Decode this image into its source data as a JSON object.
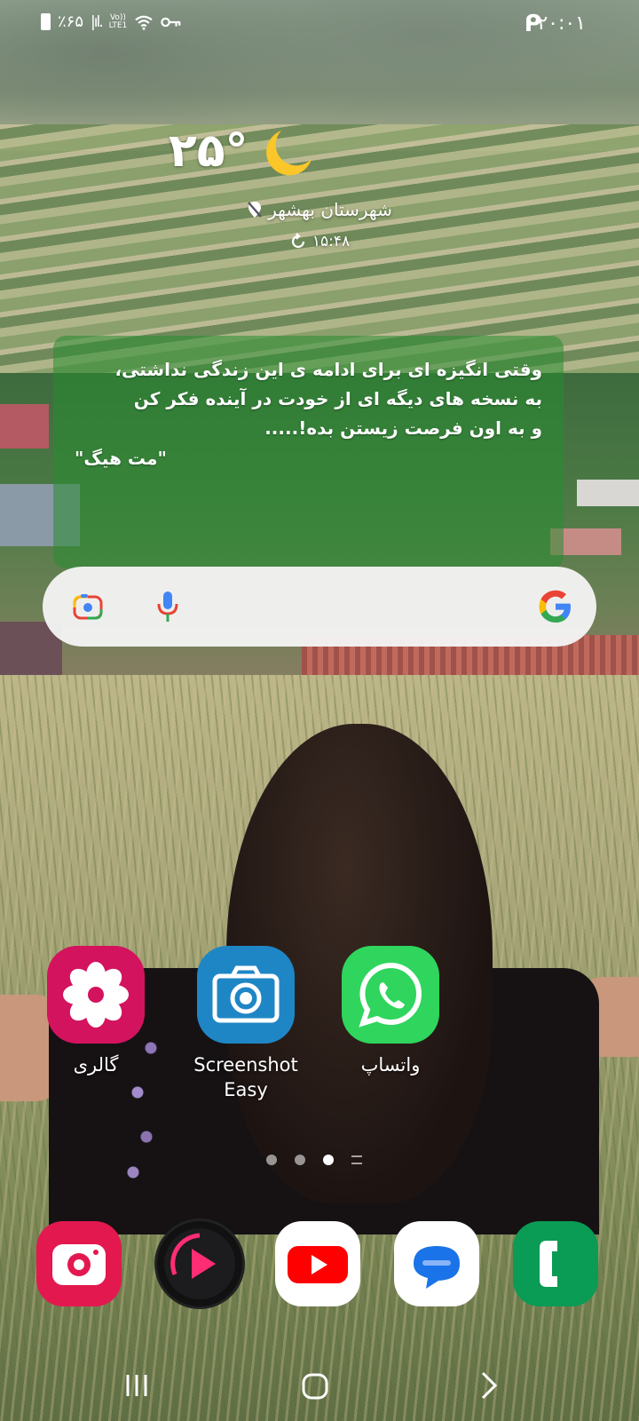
{
  "status_bar": {
    "battery_text": "٪۶۵",
    "network": "LTE1",
    "volte": "Vo))",
    "time": "۲۰:۰۱",
    "notification_icon": "p-icon"
  },
  "weather": {
    "temperature": "۲۵°",
    "condition_icon": "moon-icon",
    "location": "شهرستان بهشهر",
    "updated_time": "۱۵:۴۸"
  },
  "quote": {
    "line1": "وقتی انگیزه ای برای ادامه ی این زندگی نداشتی،",
    "line2": "به نسخه های دیگه ای از خودت در آینده فکر کن",
    "line3": "و به اون فرصت زیستن بده!.....",
    "author": "\"مت هیگ\""
  },
  "search_bar": {
    "lens_icon": "google-lens-icon",
    "mic_icon": "microphone-icon",
    "logo_icon": "google-logo-icon"
  },
  "apps": [
    {
      "label": "گالری",
      "icon": "gallery-flower-icon",
      "color": "#d3135e"
    },
    {
      "label": "Screenshot Easy",
      "icon": "camera-icon",
      "color": "#1f86c6"
    },
    {
      "label": "واتساپ",
      "icon": "whatsapp-icon",
      "color": "#2fd55c"
    }
  ],
  "dock": [
    {
      "icon": "camera-app-icon",
      "color": "#e3184f"
    },
    {
      "icon": "media-player-icon",
      "color": "#111111"
    },
    {
      "icon": "youtube-icon",
      "color": "#ff0000"
    },
    {
      "icon": "messages-icon",
      "color": "#1a73e8"
    },
    {
      "icon": "phone-icon",
      "color": "#0a9b54"
    }
  ],
  "page_indicator": {
    "pages": 3,
    "active_page": 3
  },
  "nav_bar": {
    "recents_icon": "recents-icon",
    "home_icon": "home-icon",
    "back_icon": "back-icon"
  }
}
